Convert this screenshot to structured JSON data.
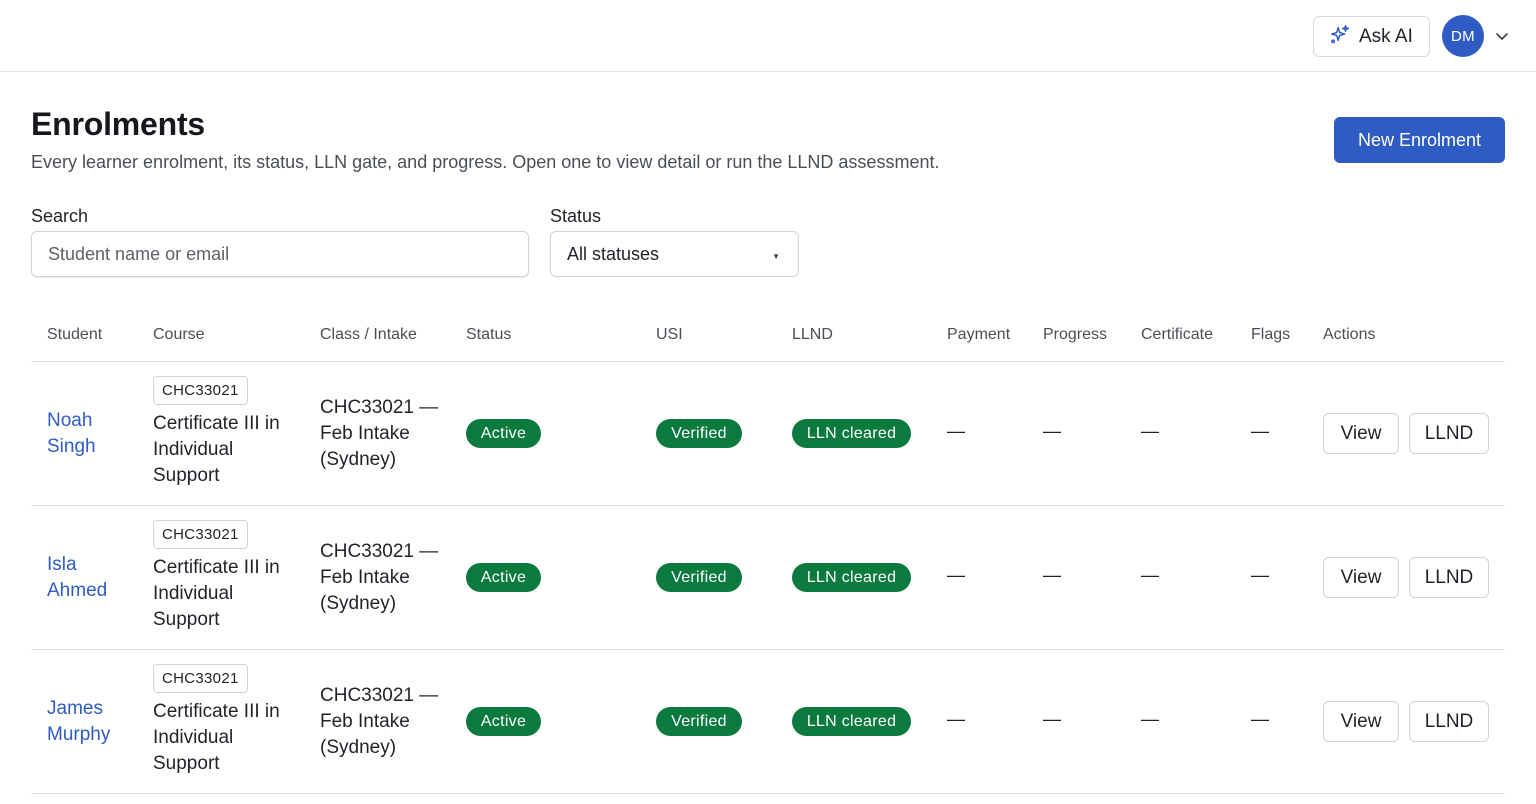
{
  "header": {
    "ask_ai_label": "Ask AI",
    "avatar_initials": "DM"
  },
  "page": {
    "title": "Enrolments",
    "description": "Every learner enrolment, its status, LLN gate, and progress. Open one to view detail or run the LLND assessment.",
    "new_button": "New Enrolment"
  },
  "filters": {
    "search_label": "Search",
    "search_placeholder": "Student name or email",
    "search_value": "",
    "status_label": "Status",
    "status_value": "All statuses"
  },
  "table": {
    "columns": [
      "Student",
      "Course",
      "Class / Intake",
      "Status",
      "USI",
      "LLND",
      "Payment",
      "Progress",
      "Certificate",
      "Flags",
      "Actions"
    ],
    "rows": [
      {
        "student": "Noah Singh",
        "course_code": "CHC33021",
        "course_name": "Certificate III in Individual Support",
        "class_intake": "CHC33021 — Feb Intake (Sydney)",
        "status": "Active",
        "usi": "Verified",
        "llnd": "LLN cleared",
        "payment": "—",
        "progress": "—",
        "certificate": "—",
        "flags": "—",
        "view_label": "View",
        "llnd_label": "LLND"
      },
      {
        "student": "Isla Ahmed",
        "course_code": "CHC33021",
        "course_name": "Certificate III in Individual Support",
        "class_intake": "CHC33021 — Feb Intake (Sydney)",
        "status": "Active",
        "usi": "Verified",
        "llnd": "LLN cleared",
        "payment": "—",
        "progress": "—",
        "certificate": "—",
        "flags": "—",
        "view_label": "View",
        "llnd_label": "LLND"
      },
      {
        "student": "James Murphy",
        "course_code": "CHC33021",
        "course_name": "Certificate III in Individual Support",
        "class_intake": "CHC33021 — Feb Intake (Sydney)",
        "status": "Active",
        "usi": "Verified",
        "llnd": "LLN cleared",
        "payment": "—",
        "progress": "—",
        "certificate": "—",
        "flags": "—",
        "view_label": "View",
        "llnd_label": "LLND"
      }
    ]
  },
  "colors": {
    "accent": "#2f5bc4",
    "badge_green": "#0b7a3f",
    "border": "#dcdfe3"
  },
  "icons": {
    "ask_ai": "sparkle-icon",
    "avatar_menu": "chevron-down-icon",
    "status_select": "caret-down-icon"
  }
}
